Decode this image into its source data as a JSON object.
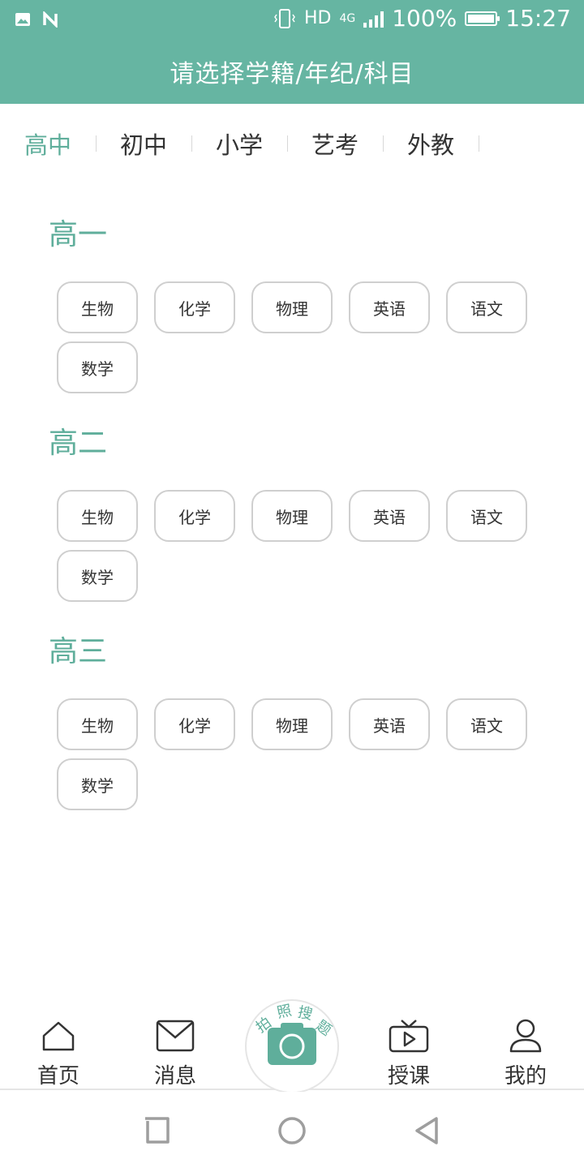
{
  "status_bar": {
    "left_icons": [
      "image-notification-icon",
      "n-notification-icon"
    ],
    "hd": "HD",
    "network": "4G",
    "battery": "100%",
    "time": "15:27"
  },
  "header": {
    "title": "请选择学籍/年纪/科目"
  },
  "tabs": [
    {
      "label": "高中",
      "active": true
    },
    {
      "label": "初中",
      "active": false
    },
    {
      "label": "小学",
      "active": false
    },
    {
      "label": "艺考",
      "active": false
    },
    {
      "label": "外教",
      "active": false
    }
  ],
  "sections": [
    {
      "title": "高一",
      "subjects": [
        "生物",
        "化学",
        "物理",
        "英语",
        "语文",
        "数学"
      ]
    },
    {
      "title": "高二",
      "subjects": [
        "生物",
        "化学",
        "物理",
        "英语",
        "语文",
        "数学"
      ]
    },
    {
      "title": "高三",
      "subjects": [
        "生物",
        "化学",
        "物理",
        "英语",
        "语文",
        "数学"
      ]
    }
  ],
  "bottom_nav": {
    "home": "首页",
    "messages": "消息",
    "camera_arc": [
      "拍",
      "照",
      "搜",
      "题"
    ],
    "lessons": "授课",
    "me": "我的"
  },
  "colors": {
    "accent": "#66b5a2",
    "accent_text": "#5fae9b",
    "chip_border": "#cfcfcf"
  }
}
